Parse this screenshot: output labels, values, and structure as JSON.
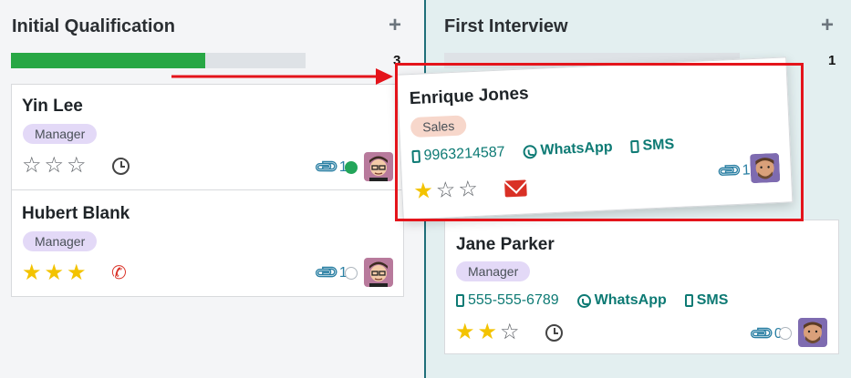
{
  "columns": [
    {
      "title": "Initial Qualification",
      "add_label": "+",
      "count": "3",
      "progress": 0.66
    },
    {
      "title": "First Interview",
      "add_label": "+",
      "count": "1",
      "progress": 0
    }
  ],
  "col1_cards": [
    {
      "name": "Yin Lee",
      "tag": "Manager",
      "stars": 0,
      "activity": "clock",
      "attachments": "1",
      "status": "green"
    },
    {
      "name": "Hubert Blank",
      "tag": "Manager",
      "stars": 3,
      "activity": "phone",
      "attachments": "1",
      "status": "grey"
    }
  ],
  "dragged_card": {
    "name": "Enrique Jones",
    "tag": "Sales",
    "phone": "9963214587",
    "whatsapp": "WhatsApp",
    "sms": "SMS",
    "stars": 1,
    "activity": "email",
    "attachments": "1"
  },
  "col2_cards": [
    {
      "name": "Jane Parker",
      "tag": "Manager",
      "phone": "555-555-6789",
      "whatsapp": "WhatsApp",
      "sms": "SMS",
      "stars": 2,
      "activity": "clock",
      "attachments": "0",
      "status": "grey"
    }
  ],
  "icons": {
    "star_full": "★",
    "star_empty": "☆",
    "phone": "✆",
    "paperclip": "⊘"
  },
  "colors": {
    "accent_teal": "#0d7a74",
    "progress_green": "#28a745",
    "highlight_red": "#e4141b",
    "star_gold": "#f3c300"
  }
}
